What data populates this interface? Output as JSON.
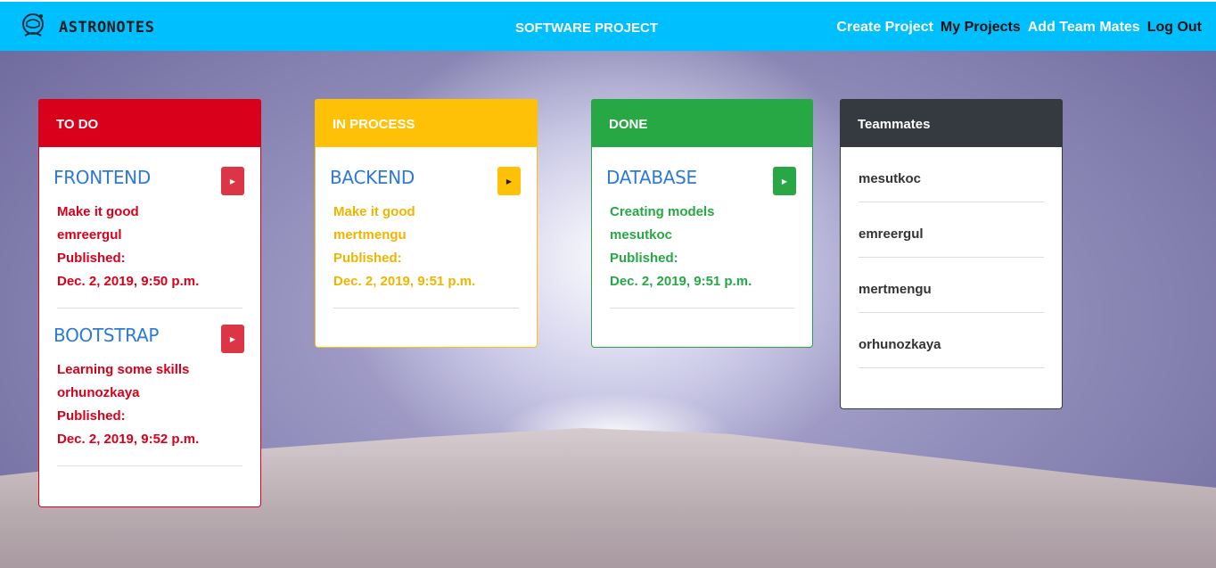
{
  "brand": {
    "name": "ASTRONOTES",
    "icon": "astronaut-helmet-icon"
  },
  "header": {
    "project_title": "SOFTWARE PROJECT"
  },
  "nav": {
    "create_project": "Create Project",
    "my_projects": "My Projects",
    "add_team_mates": "Add Team Mates",
    "log_out": "Log Out"
  },
  "columns": {
    "todo": {
      "title": "TO DO",
      "color": "#d9001b",
      "tasks": [
        {
          "title": "FRONTEND",
          "description": "Make it good",
          "author": "emreergul",
          "published_label": "Published:",
          "date": "Dec. 2, 2019, 9:50 p.m."
        },
        {
          "title": "BOOTSTRAP",
          "description": "Learning some skills",
          "author": "orhunozkaya",
          "published_label": "Published:",
          "date": "Dec. 2, 2019, 9:52 p.m."
        }
      ]
    },
    "in_process": {
      "title": "IN PROCESS",
      "color": "#ffc107",
      "tasks": [
        {
          "title": "BACKEND",
          "description": "Make it good",
          "author": "mertmengu",
          "published_label": "Published:",
          "date": "Dec. 2, 2019, 9:51 p.m."
        }
      ]
    },
    "done": {
      "title": "DONE",
      "color": "#28a745",
      "tasks": [
        {
          "title": "DATABASE",
          "description": "Creating models",
          "author": "mesutkoc",
          "published_label": "Published:",
          "date": "Dec. 2, 2019, 9:51 p.m."
        }
      ]
    }
  },
  "teammates": {
    "title": "Teammates",
    "members": [
      "mesutkoc",
      "emreergul",
      "mertmengu",
      "orhunozkaya"
    ]
  },
  "colors": {
    "navbar": "#00bfff",
    "link_accent": "#2c7ad6"
  }
}
